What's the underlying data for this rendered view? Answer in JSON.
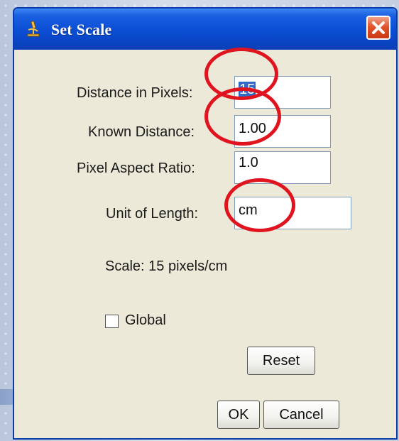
{
  "dialog": {
    "title": "Set Scale",
    "icon": "microscope-icon",
    "close_icon": "close-icon"
  },
  "form": {
    "distance_in_pixels": {
      "label": "Distance in Pixels:",
      "value": "15",
      "selected": true
    },
    "known_distance": {
      "label": "Known Distance:",
      "value": "1.00"
    },
    "pixel_aspect_ratio": {
      "label": "Pixel Aspect Ratio:",
      "value": "1.0"
    },
    "unit_of_length": {
      "label": "Unit of Length:",
      "value": "cm"
    }
  },
  "scale_text": "Scale: 15 pixels/cm",
  "global_checkbox": {
    "label": "Global",
    "checked": false
  },
  "buttons": {
    "reset": "Reset",
    "ok": "OK",
    "cancel": "Cancel"
  },
  "colors": {
    "titlebar": "#0b4fd6",
    "annotation": "#e0141e",
    "selection": "#316ac5",
    "dialog_bg": "#ece9d8"
  }
}
